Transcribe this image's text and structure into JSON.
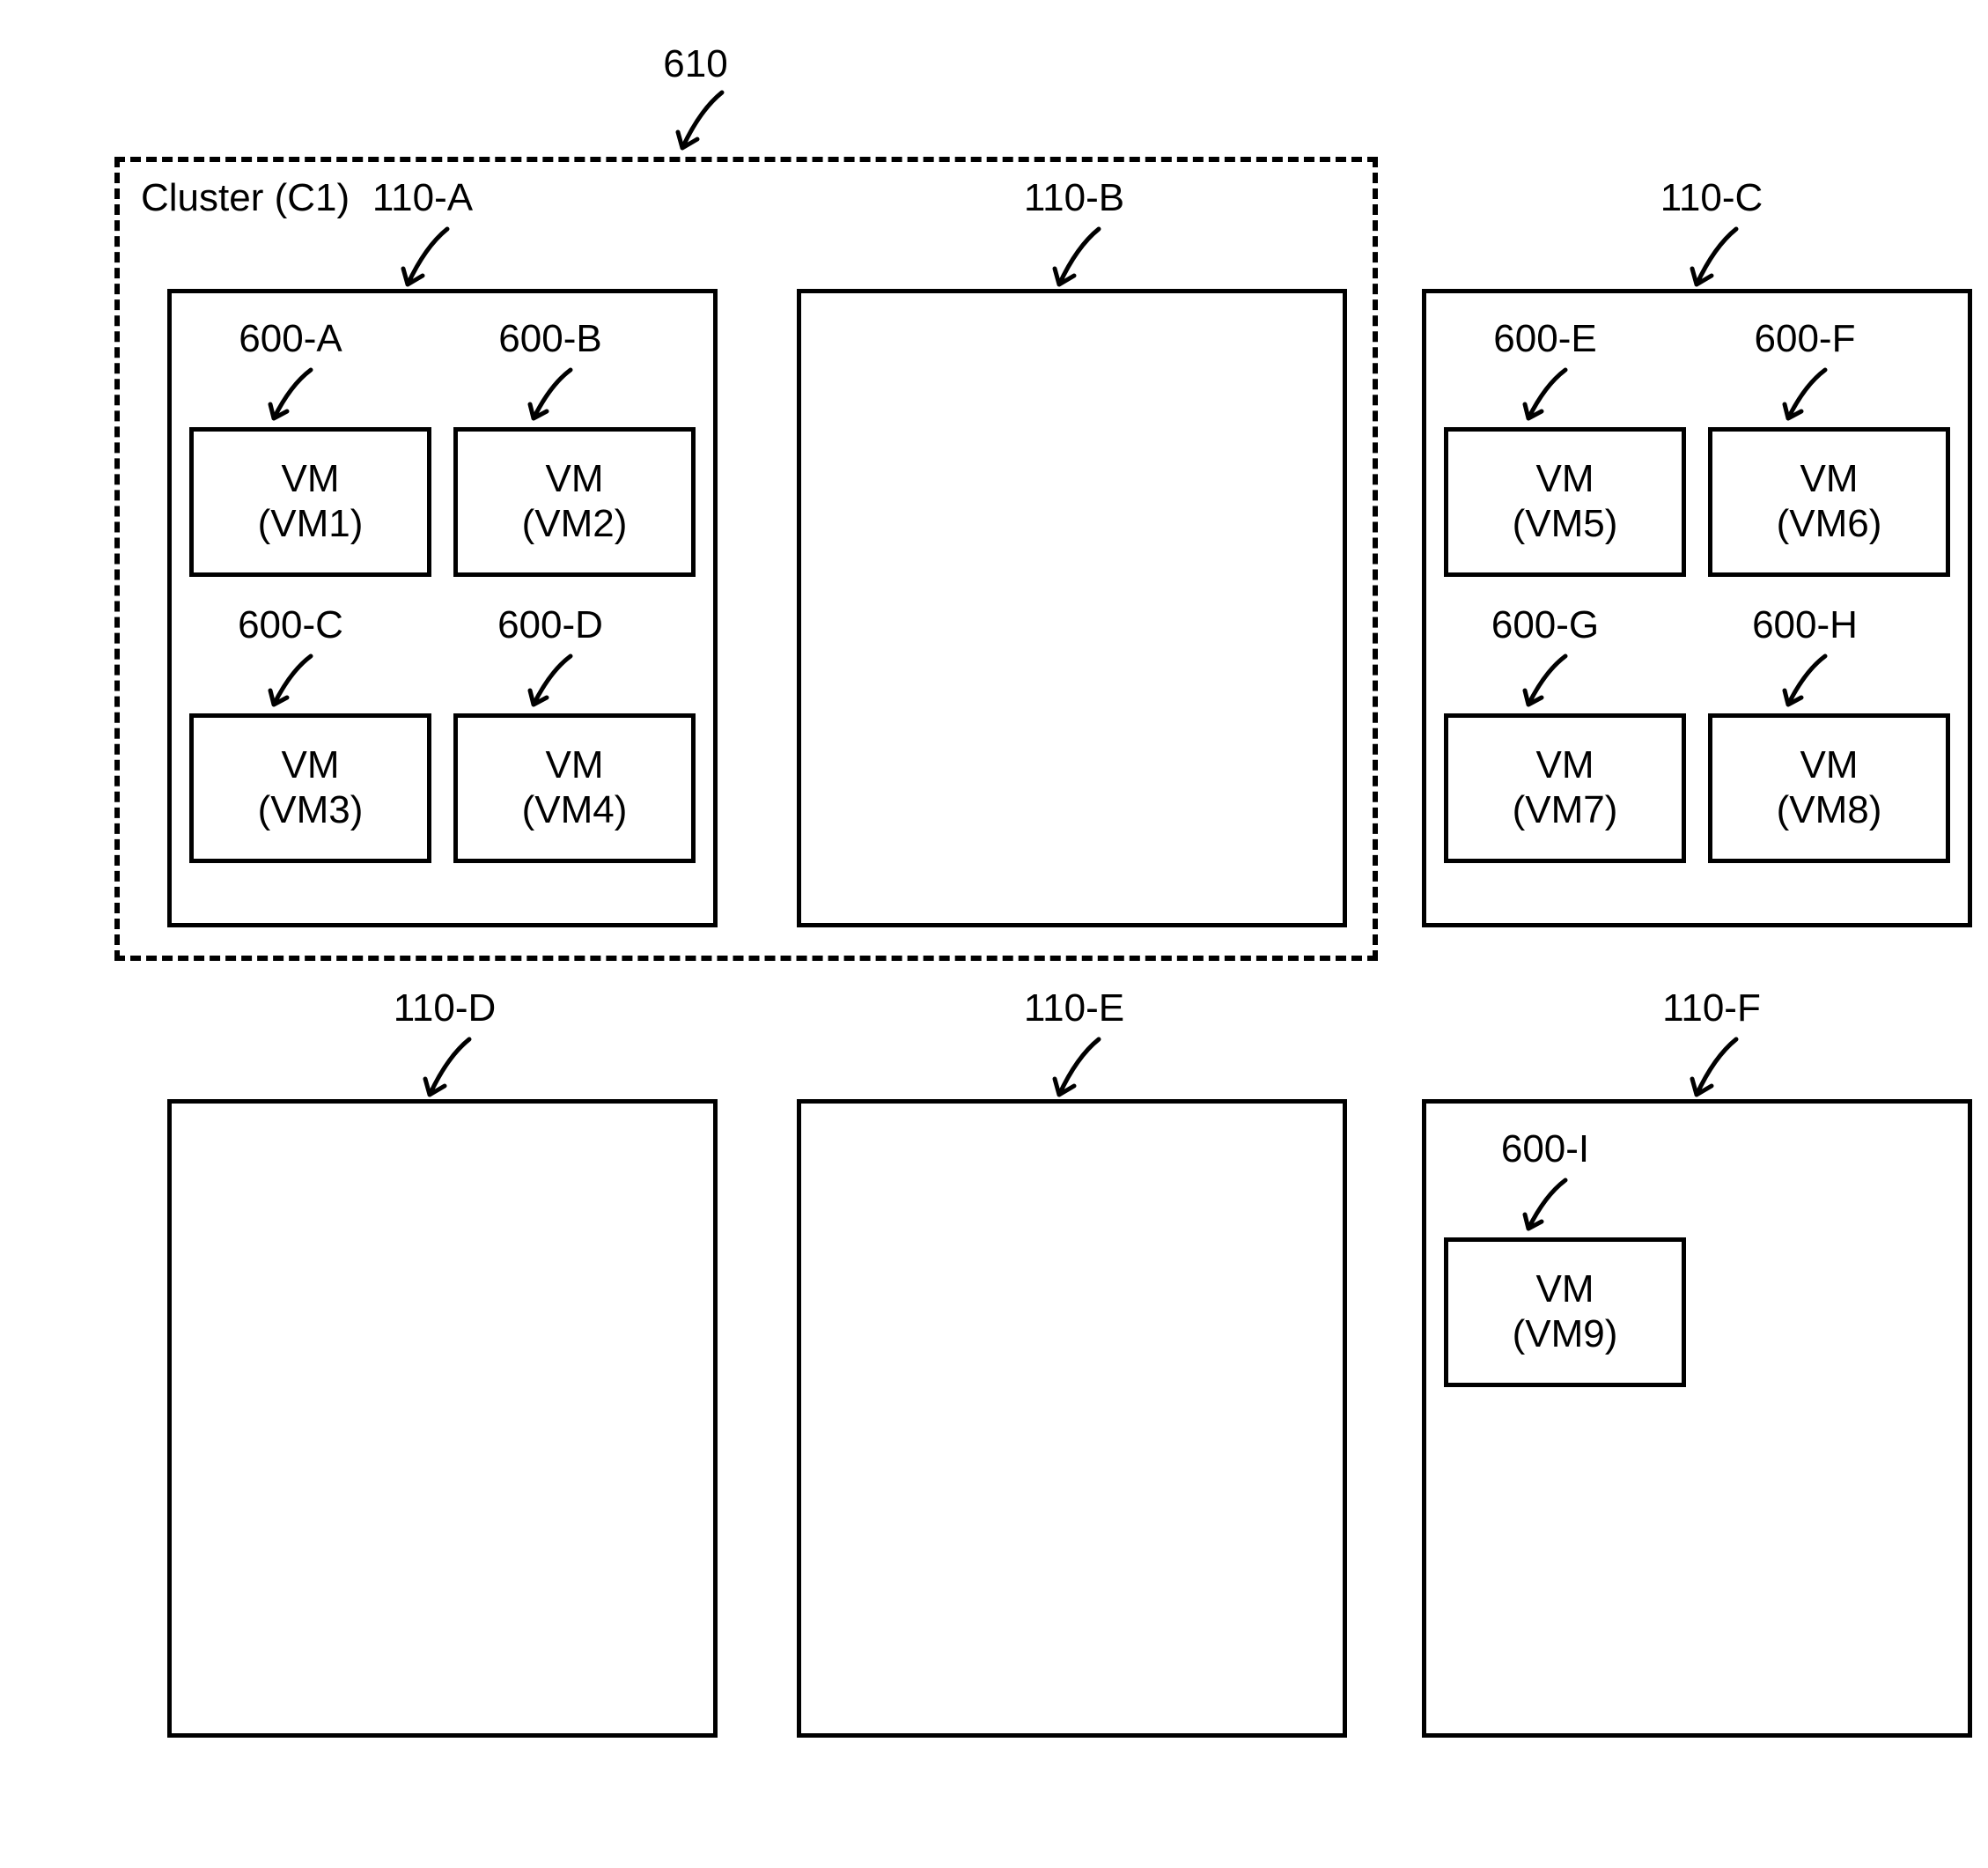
{
  "refs": {
    "cluster_top": "610",
    "cluster_label": "Cluster (C1)",
    "host_110A": "110-A",
    "host_110B": "110-B",
    "host_110C": "110-C",
    "host_110D": "110-D",
    "host_110E": "110-E",
    "host_110F": "110-F",
    "vm_600A": "600-A",
    "vm_600B": "600-B",
    "vm_600C": "600-C",
    "vm_600D": "600-D",
    "vm_600E": "600-E",
    "vm_600F": "600-F",
    "vm_600G": "600-G",
    "vm_600H": "600-H",
    "vm_600I": "600-I"
  },
  "vm_names": {
    "vm_word": "VM",
    "vm1": "(VM1)",
    "vm2": "(VM2)",
    "vm3": "(VM3)",
    "vm4": "(VM4)",
    "vm5": "(VM5)",
    "vm6": "(VM6)",
    "vm7": "(VM7)",
    "vm8": "(VM8)",
    "vm9": "(VM9)"
  }
}
